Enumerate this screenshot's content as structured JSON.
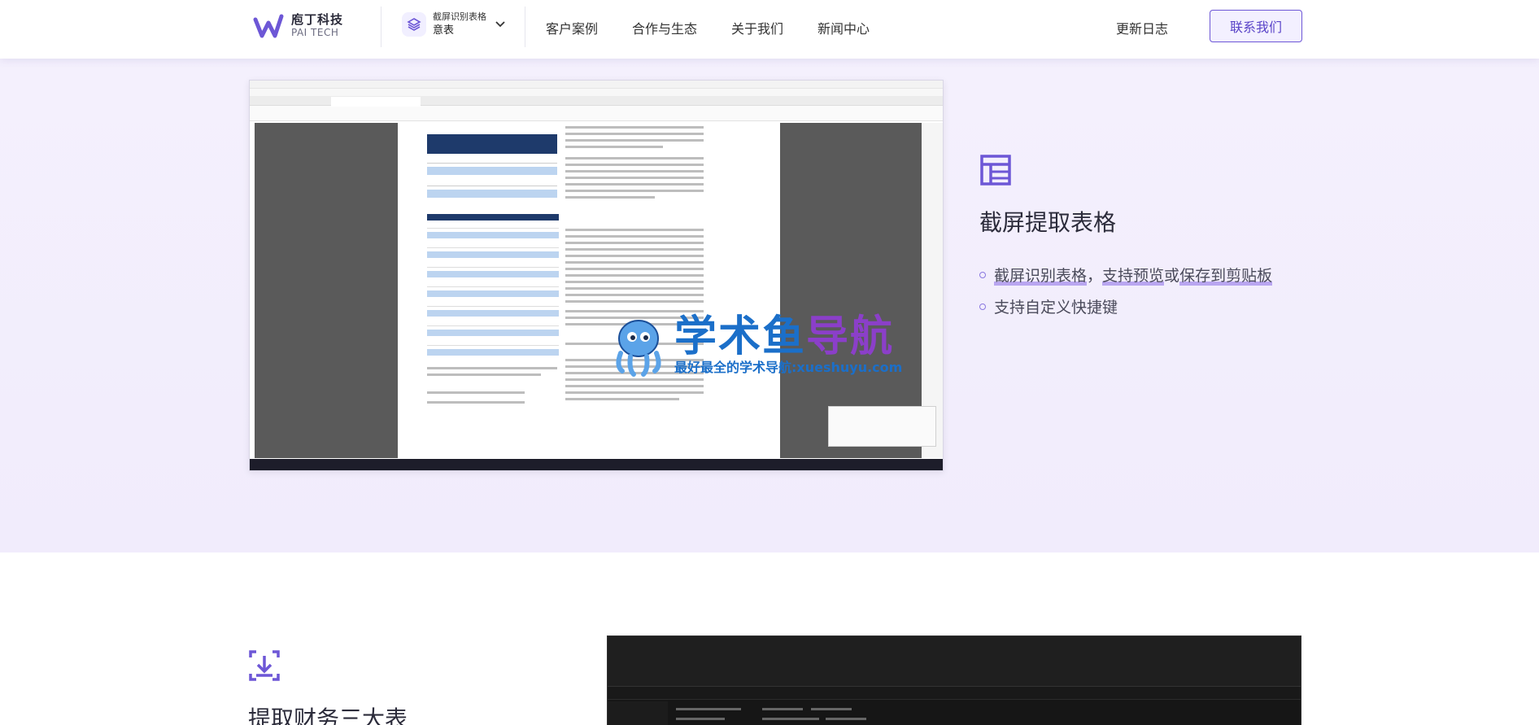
{
  "header": {
    "logo_cn": "庖丁科技",
    "logo_en": "PAI TECH",
    "product_name": "截屏识别表格",
    "product_sub": "意表",
    "nav": [
      "客户案例",
      "合作与生态",
      "关于我们",
      "新闻中心"
    ],
    "update_log": "更新日志",
    "contact": "联系我们"
  },
  "watermark": {
    "title_a": "学术鱼",
    "title_b": "导航",
    "subtitle": "最好最全的学术导航:xueshuyu.com"
  },
  "feature1": {
    "icon": "table-icon",
    "title": "截屏提取表格",
    "bullet1_part1": "截屏识别表格",
    "bullet1_sep": "，",
    "bullet1_part2": "支持预览",
    "bullet1_part3": "或",
    "bullet1_part4": "保存到剪贴板",
    "bullet2": "支持自定义快捷键"
  },
  "feature2": {
    "icon": "download-box-icon",
    "title": "提取财务三大表"
  },
  "colors": {
    "accent": "#6d57d6",
    "section_bg": "#f3effd",
    "watermark_blue": "#1b6fc9",
    "watermark_purple": "#8b3fc9"
  }
}
